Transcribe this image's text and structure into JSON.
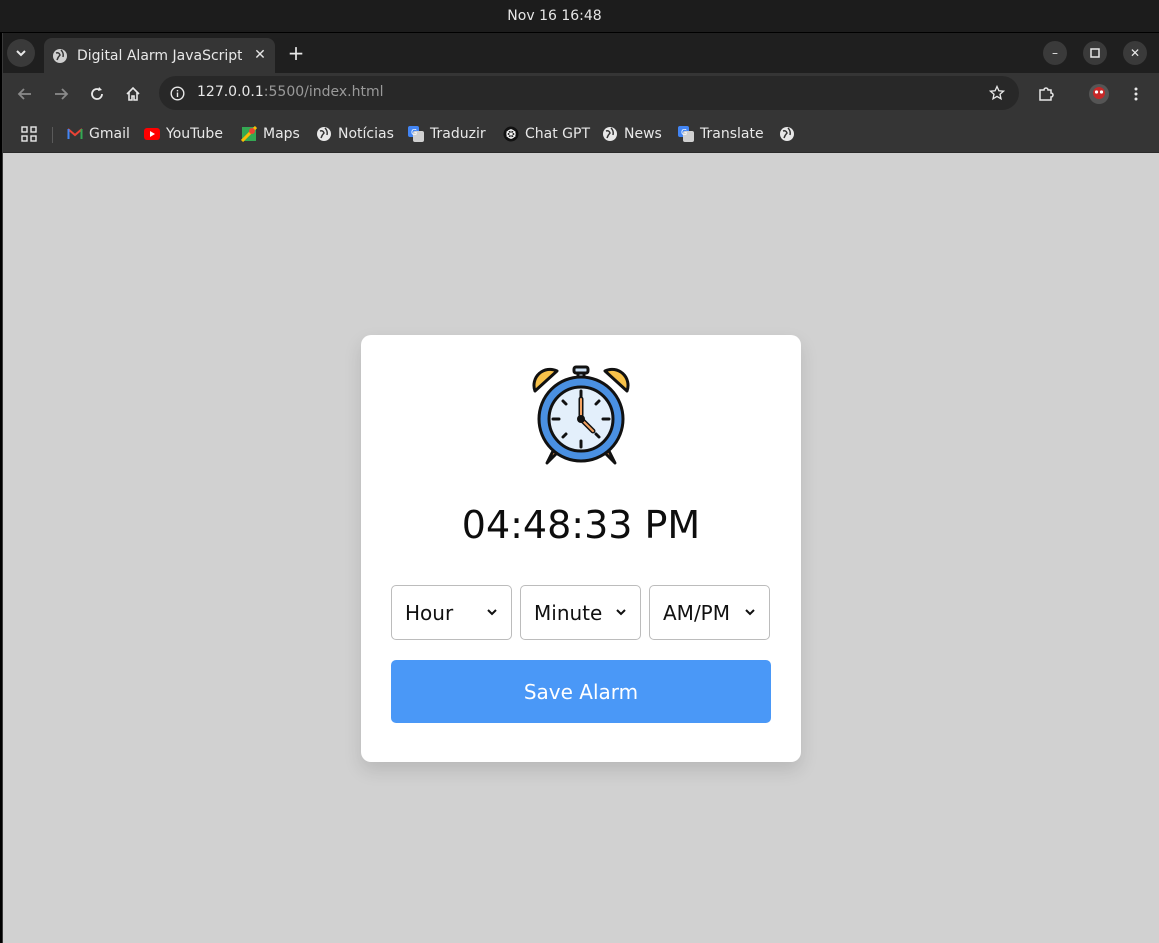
{
  "os": {
    "clock": "Nov 16  16:48"
  },
  "browser": {
    "tab": {
      "title": "Digital Alarm JavaScript |"
    },
    "address": {
      "host": "127.0.0.1",
      "rest": ":5500/index.html"
    },
    "bookmarks": [
      {
        "label": "Gmail",
        "icon": "gmail-icon"
      },
      {
        "label": "YouTube",
        "icon": "youtube-icon"
      },
      {
        "label": "Maps",
        "icon": "maps-icon"
      },
      {
        "label": "Notícias",
        "icon": "globe-icon"
      },
      {
        "label": "Traduzir",
        "icon": "translate-icon"
      },
      {
        "label": "Chat GPT",
        "icon": "chatgpt-icon"
      },
      {
        "label": "News",
        "icon": "globe-icon"
      },
      {
        "label": "Translate",
        "icon": "translate-icon"
      }
    ]
  },
  "app": {
    "time": "04:48:33 PM",
    "selects": {
      "hour": "Hour",
      "minute": "Minute",
      "ampm": "AM/PM"
    },
    "save_label": "Save Alarm",
    "colors": {
      "accent": "#4a98f7",
      "background": "#d1d1d1",
      "card": "#ffffff"
    }
  }
}
